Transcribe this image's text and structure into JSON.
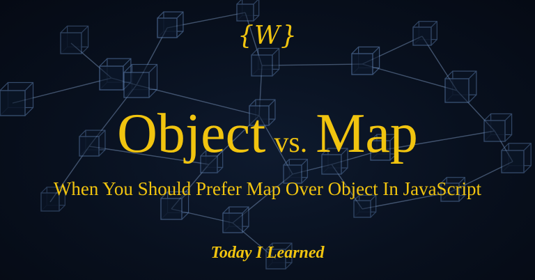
{
  "logo": {
    "text": "{W}",
    "icon": "curly-brace-w-logo-icon"
  },
  "title": {
    "left": "Object",
    "middle": "vs.",
    "right": "Map"
  },
  "subtitle": "When You Should Prefer Map Over Object In JavaScript",
  "tagline": "Today I Learned",
  "background": {
    "theme": "3d-network-of-cubes",
    "background_color": "#070d19",
    "cube_color": "#5d7fb0",
    "edge_color": "#6f88ad"
  },
  "colors": {
    "accent": "#f1c40f"
  }
}
